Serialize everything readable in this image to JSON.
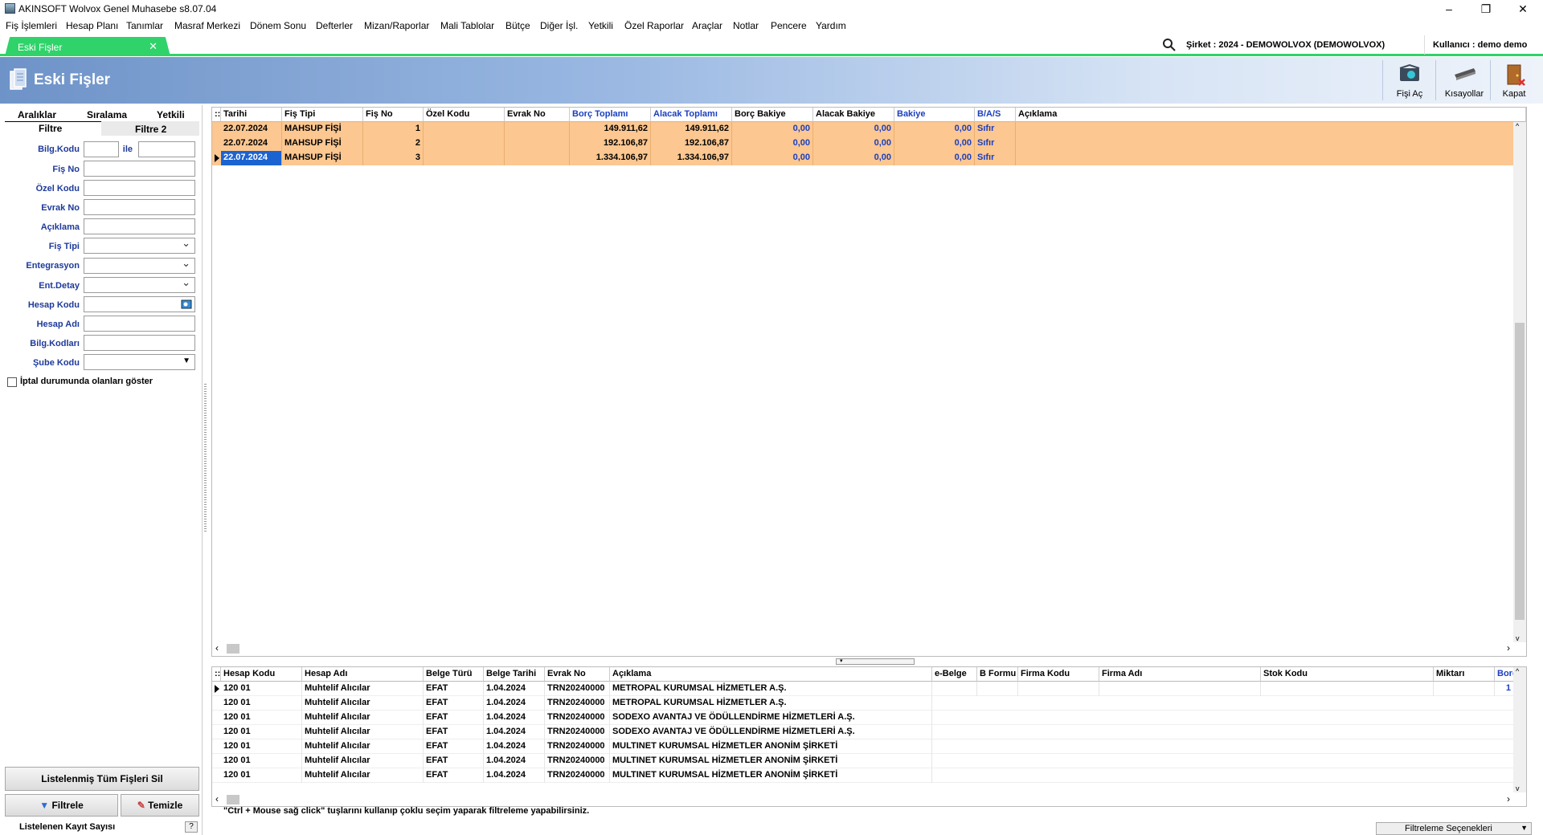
{
  "window": {
    "title": "AKINSOFT Wolvox Genel Muhasebe s8.07.04"
  },
  "menu": [
    "Fiş İşlemleri",
    "Hesap Planı",
    "Tanımlar",
    "Masraf Merkezi",
    "Dönem Sonu",
    "Defterler",
    "Mizan/Raporlar",
    "Mali Tablolar",
    "Bütçe",
    "Diğer İşl.",
    "Yetkili",
    "Özel Raporlar",
    "Araçlar",
    "Notlar",
    "Pencere",
    "Yardım"
  ],
  "doc_tab": {
    "label": "Eski Fişler"
  },
  "company": "Şirket : 2024 - DEMOWOLVOX (DEMOWOLVOX)",
  "user": "Kullanıcı : demo demo",
  "header": {
    "title": "Eski Fişler"
  },
  "toolbar": {
    "open": "Fişi Aç",
    "shortcuts": "Kısayollar",
    "close": "Kapat"
  },
  "left": {
    "tabs": [
      "Aralıklar",
      "Sıralama",
      "Yetkili"
    ],
    "subtabs": [
      "Filtre",
      "Filtre 2"
    ],
    "fields": {
      "bilg_kodu": "Bilg.Kodu",
      "ile": "ile",
      "fis_no": "Fiş No",
      "ozel_kodu": "Özel Kodu",
      "evrak_no": "Evrak No",
      "aciklama": "Açıklama",
      "fis_tipi": "Fiş Tipi",
      "entegrasyon": "Entegrasyon",
      "ent_detay": "Ent.Detay",
      "hesap_kodu": "Hesap Kodu",
      "hesap_adi": "Hesap Adı",
      "bilg_kodlari": "Bilg.Kodları",
      "sube_kodu": "Şube Kodu"
    },
    "cancel_checkbox": "İptal durumunda olanları göster",
    "delete_all": "Listelenmiş Tüm Fişleri Sil",
    "filter": "Filtrele",
    "clear": "Temizle",
    "record_count": "Listelenen Kayıt Sayısı",
    "help": "?"
  },
  "grid1": {
    "columns": [
      "Tarihi",
      "Fiş Tipi",
      "Fiş No",
      "Özel Kodu",
      "Evrak No",
      "Borç Toplamı",
      "Alacak Toplamı",
      "Borç Bakiye",
      "Alacak Bakiye",
      "Bakiye",
      "B/A/S",
      "Açıklama"
    ],
    "rows": [
      [
        "22.07.2024",
        "MAHSUP FİŞİ",
        "1",
        "",
        "",
        "149.911,62",
        "149.911,62",
        "0,00",
        "0,00",
        "0,00",
        "Sıfır",
        ""
      ],
      [
        "22.07.2024",
        "MAHSUP FİŞİ",
        "2",
        "",
        "",
        "192.106,87",
        "192.106,87",
        "0,00",
        "0,00",
        "0,00",
        "Sıfır",
        ""
      ],
      [
        "22.07.2024",
        "MAHSUP FİŞİ",
        "3",
        "",
        "",
        "1.334.106,97",
        "1.334.106,97",
        "0,00",
        "0,00",
        "0,00",
        "Sıfır",
        ""
      ]
    ]
  },
  "grid2": {
    "columns": [
      "Hesap Kodu",
      "Hesap Adı",
      "Belge Türü",
      "Belge Tarihi",
      "Evrak No",
      "Açıklama",
      "e-Belge",
      "B Formu",
      "Firma Kodu",
      "Firma Adı",
      "Stok Kodu",
      "Miktarı",
      "Borç"
    ],
    "rows": [
      [
        "120 01",
        "Muhtelif Alıcılar",
        "EFAT",
        "1.04.2024",
        "TRN20240000",
        "METROPAL KURUMSAL HİZMETLER A.Ş."
      ],
      [
        "120 01",
        "Muhtelif Alıcılar",
        "EFAT",
        "1.04.2024",
        "TRN20240000",
        "METROPAL KURUMSAL HİZMETLER A.Ş."
      ],
      [
        "120 01",
        "Muhtelif Alıcılar",
        "EFAT",
        "1.04.2024",
        "TRN20240000",
        "SODEXO AVANTAJ VE ÖDÜLLENDİRME HİZMETLERİ A.Ş."
      ],
      [
        "120 01",
        "Muhtelif Alıcılar",
        "EFAT",
        "1.04.2024",
        "TRN20240000",
        "SODEXO AVANTAJ VE ÖDÜLLENDİRME HİZMETLERİ A.Ş."
      ],
      [
        "120 01",
        "Muhtelif Alıcılar",
        "EFAT",
        "1.04.2024",
        "TRN20240000",
        "MULTINET KURUMSAL HİZMETLER ANONİM ŞİRKETİ"
      ],
      [
        "120 01",
        "Muhtelif Alıcılar",
        "EFAT",
        "1.04.2024",
        "TRN20240000",
        "MULTINET KURUMSAL HİZMETLER ANONİM ŞİRKETİ"
      ],
      [
        "120 01",
        "Muhtelif Alıcılar",
        "EFAT",
        "1.04.2024",
        "TRN20240000",
        "MULTINET KURUMSAL HİZMETLER ANONİM ŞİRKETİ"
      ]
    ],
    "borc_partial": "1"
  },
  "hint": "\"Ctrl + Mouse sağ click\" tuşlarını kullanıp çoklu seçim yaparak filtreleme yapabilirsiniz.",
  "filter_options": "Filtreleme Seçenekleri",
  "colors": {
    "row_bg": "#fcc790",
    "tab_green": "#2fd36a",
    "label_blue": "#1e3a9a",
    "selection": "#1b63d1"
  },
  "icons": [
    "app-icon",
    "search-icon",
    "open-receipt-icon",
    "shortcuts-icon",
    "exit-door-icon",
    "filter-funnel-icon",
    "eraser-icon",
    "lookup-icon"
  ]
}
